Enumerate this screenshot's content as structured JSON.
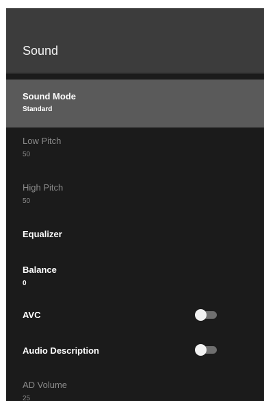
{
  "header": {
    "title": "Sound"
  },
  "items": [
    {
      "label": "Sound Mode",
      "value": "Standard",
      "selected": true,
      "enabled": true
    },
    {
      "label": "Low Pitch",
      "value": "50",
      "selected": false,
      "enabled": false
    },
    {
      "label": "High Pitch",
      "value": "50",
      "selected": false,
      "enabled": false
    },
    {
      "label": "Equalizer",
      "selected": false,
      "enabled": true
    },
    {
      "label": "Balance",
      "value": "0",
      "selected": false,
      "enabled": true
    },
    {
      "label": "AVC",
      "toggle": "off",
      "enabled": true
    },
    {
      "label": "Audio Description",
      "toggle": "off",
      "enabled": true
    },
    {
      "label": "AD Volume",
      "value": "25",
      "selected": false,
      "enabled": false
    }
  ]
}
